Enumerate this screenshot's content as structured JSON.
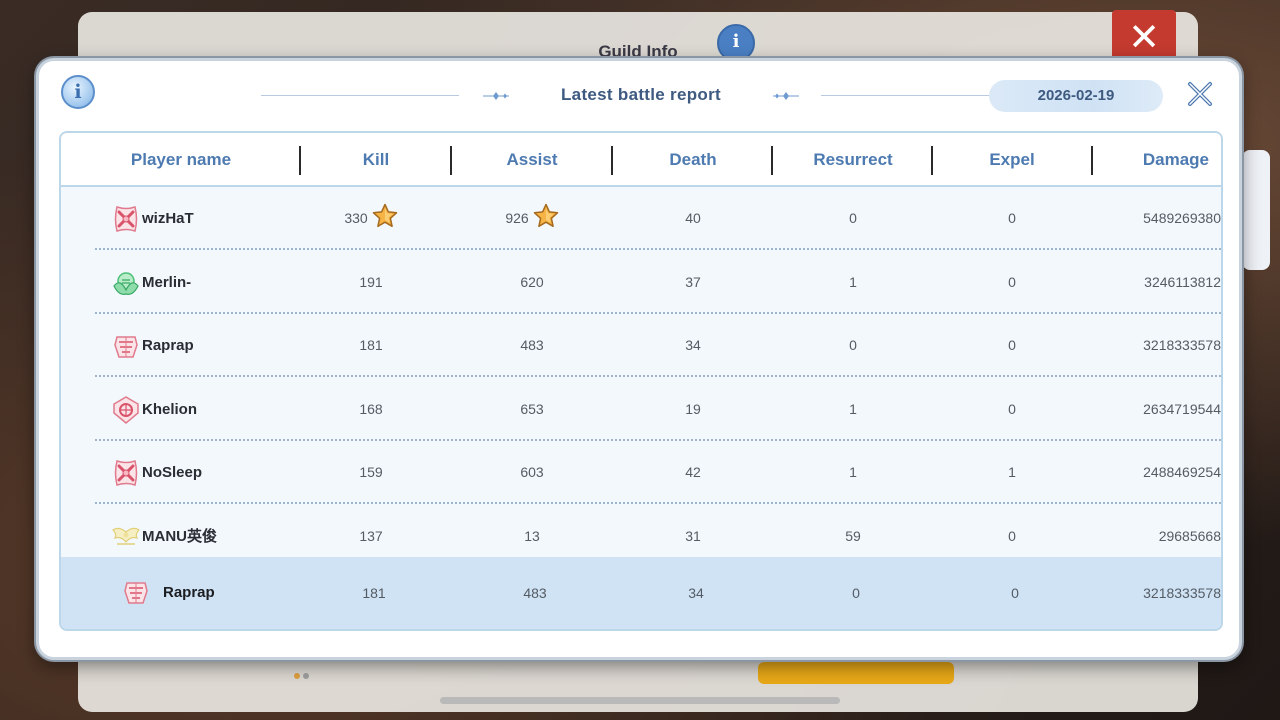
{
  "background": {
    "panel_title": "Guild Info"
  },
  "dialog": {
    "title": "Latest battle report",
    "date": "2026-02-19",
    "info_icon": "info-icon",
    "close_icon": "close-icon"
  },
  "table": {
    "columns": [
      "Player name",
      "Kill",
      "Assist",
      "Death",
      "Resurrect",
      "Expel",
      "Damage"
    ],
    "rows": [
      {
        "name": "wizHaT",
        "kill": "330",
        "assist": "926",
        "death": "40",
        "resurrect": "0",
        "expel": "0",
        "damage": "5489269380",
        "icon": "crossed-swords-guild-icon",
        "kill_star": true,
        "assist_star": true
      },
      {
        "name": "Merlin-",
        "kill": "191",
        "assist": "620",
        "death": "37",
        "resurrect": "1",
        "expel": "0",
        "damage": "3246113812",
        "icon": "green-emblem-guild-icon"
      },
      {
        "name": "Raprap",
        "kill": "181",
        "assist": "483",
        "death": "34",
        "resurrect": "0",
        "expel": "0",
        "damage": "3218333578",
        "icon": "helmet-guild-icon"
      },
      {
        "name": "Khelion",
        "kill": "168",
        "assist": "653",
        "death": "19",
        "resurrect": "1",
        "expel": "0",
        "damage": "2634719544",
        "icon": "shield-guild-icon"
      },
      {
        "name": "NoSleep",
        "kill": "159",
        "assist": "603",
        "death": "42",
        "resurrect": "1",
        "expel": "1",
        "damage": "2488469254",
        "icon": "crossed-swords-guild-icon"
      },
      {
        "name": "MANU英俊",
        "kill": "137",
        "assist": "13",
        "death": "31",
        "resurrect": "59",
        "expel": "0",
        "damage": "29685668",
        "icon": "gold-wings-guild-icon"
      }
    ],
    "self_row": {
      "name": "Raprap",
      "kill": "181",
      "assist": "483",
      "death": "34",
      "resurrect": "0",
      "expel": "0",
      "damage": "3218333578",
      "icon": "helmet-guild-icon"
    }
  },
  "colors": {
    "accent": "#4d7ab0",
    "header_text": "#3e5a80",
    "self_row_bg": "#cfe3f5",
    "star": "#f2a93b"
  }
}
